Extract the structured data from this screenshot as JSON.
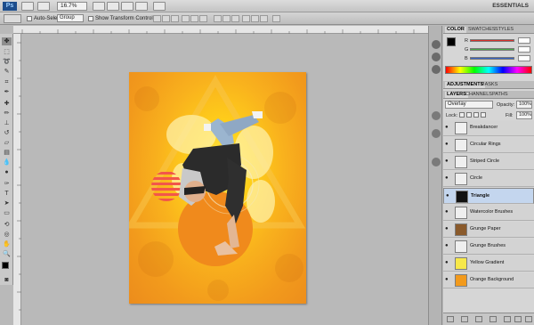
{
  "app_bar": {
    "logo": "Ps",
    "zoom": "16.7%",
    "workspace": "ESSENTIALS"
  },
  "options_bar": {
    "auto_select_label": "Auto-Select:",
    "auto_select_value": "Group",
    "show_transform_label": "Show Transform Controls"
  },
  "color_panel": {
    "tabs": [
      "COLOR",
      "SWATCHES",
      "STYLES"
    ],
    "channels": [
      {
        "label": "R",
        "value": "",
        "color": "#d9302a"
      },
      {
        "label": "G",
        "value": "",
        "color": "#4aa84a"
      },
      {
        "label": "B",
        "value": "",
        "color": "#3563c7"
      }
    ]
  },
  "adjustments_panel": {
    "tabs": [
      "ADJUSTMENTS",
      "MASKS"
    ]
  },
  "layers_panel": {
    "tabs": [
      "LAYERS",
      "CHANNELS",
      "PATHS"
    ],
    "blend_mode": "Overlay",
    "opacity_label": "Opacity:",
    "opacity_value": "100%",
    "lock_label": "Lock:",
    "fill_label": "Fill:",
    "fill_value": "100%",
    "layers": [
      {
        "name": "Breakdancer",
        "thumb": "#f0f0f0",
        "selected": false
      },
      {
        "name": "Circular Rings",
        "thumb": "#efefef",
        "selected": false
      },
      {
        "name": "Striped Circle",
        "thumb": "#efefef",
        "selected": false
      },
      {
        "name": "Circle",
        "thumb": "#efefef",
        "selected": false
      },
      {
        "name": "Triangle",
        "thumb": "#111111",
        "selected": true
      },
      {
        "name": "Watercolor Brushes",
        "thumb": "#efefef",
        "selected": false
      },
      {
        "name": "Grunge Paper",
        "thumb": "#8a5a2b",
        "selected": false
      },
      {
        "name": "Grunge Brushes",
        "thumb": "#efefef",
        "selected": false
      },
      {
        "name": "Yellow Gradient",
        "thumb": "#f7e84a",
        "selected": false
      },
      {
        "name": "Orange Background",
        "thumb": "#f29a1c",
        "selected": false
      }
    ]
  },
  "colors": {
    "canvas_orange": "#f29a1c",
    "canvas_yellow": "#fde85a",
    "selected_layer": "#c4d6ee"
  }
}
